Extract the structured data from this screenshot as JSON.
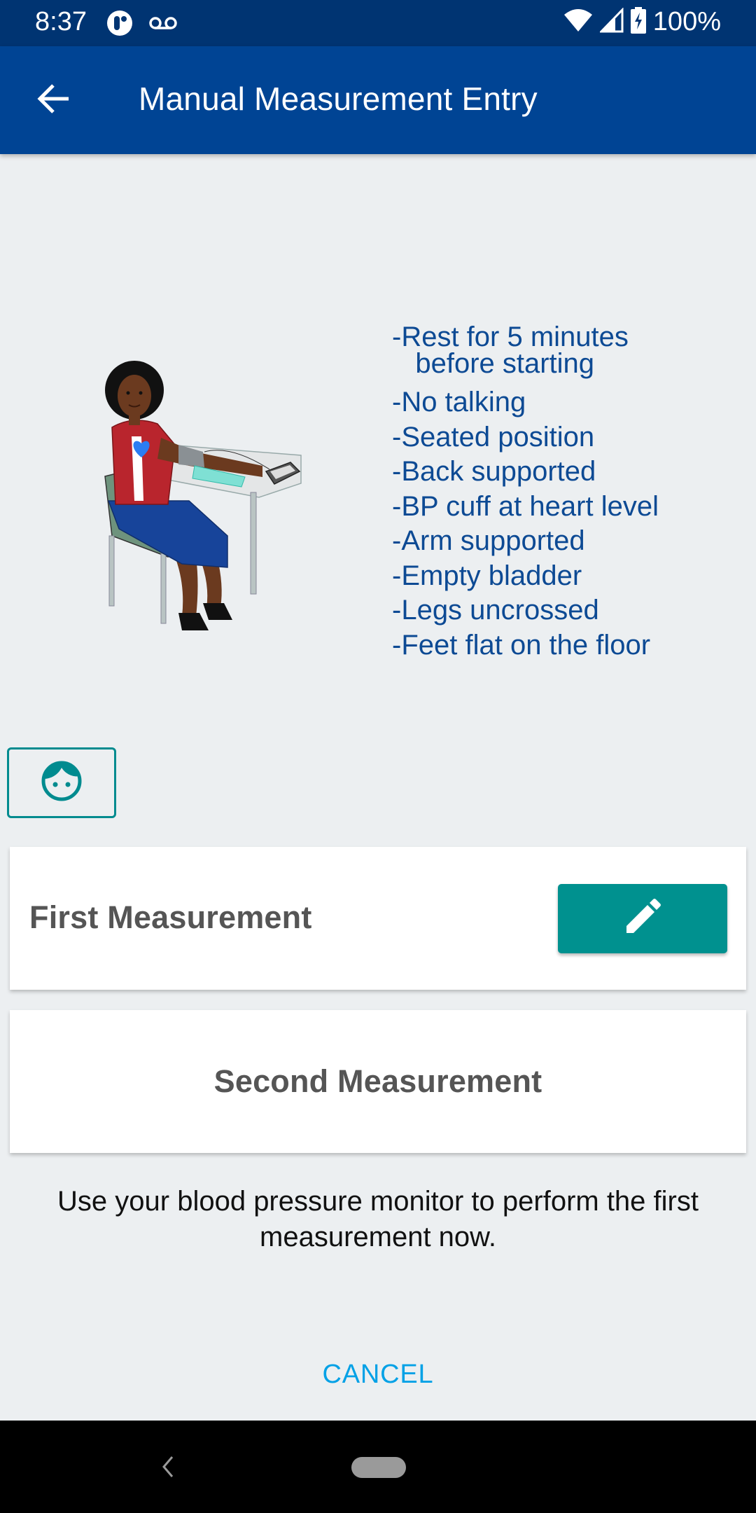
{
  "status_bar": {
    "time": "8:37",
    "left_icons": [
      "app-notification-icon",
      "voicemail-icon"
    ],
    "right_icons": [
      "wifi-icon",
      "cell-signal-icon",
      "battery-charging-icon"
    ],
    "battery_percent": "100%"
  },
  "app_bar": {
    "title": "Manual Measurement Entry",
    "back_icon": "arrow-back-icon"
  },
  "illustration": {
    "description": "Woman seated at a table with blood pressure cuff on arm and monitor",
    "icon": "bp-measurement-illustration"
  },
  "instructions": [
    "-Rest for 5 minutes\n   before starting",
    "-No talking",
    "-Seated position",
    "-Back supported",
    "-BP cuff at heart level",
    "-Arm supported",
    "-Empty bladder",
    "-Legs uncrossed",
    "-Feet flat on the floor"
  ],
  "avatar_button": {
    "icon": "face-icon"
  },
  "measurements": {
    "first": {
      "label": "First Measurement",
      "edit_icon": "pencil-icon"
    },
    "second": {
      "label": "Second Measurement"
    }
  },
  "hint": "Use your blood pressure monitor to perform the first measurement now.",
  "cancel_label": "CANCEL",
  "colors": {
    "status_bar": "#003472",
    "app_bar": "#004494",
    "instruction_text": "#0d4a94",
    "teal_accent": "#00918f",
    "cancel_text": "#03a1e6",
    "background": "#eceff1"
  },
  "nav_bar": {
    "back_icon": "nav-back-icon",
    "home_icon": "nav-home-pill"
  }
}
